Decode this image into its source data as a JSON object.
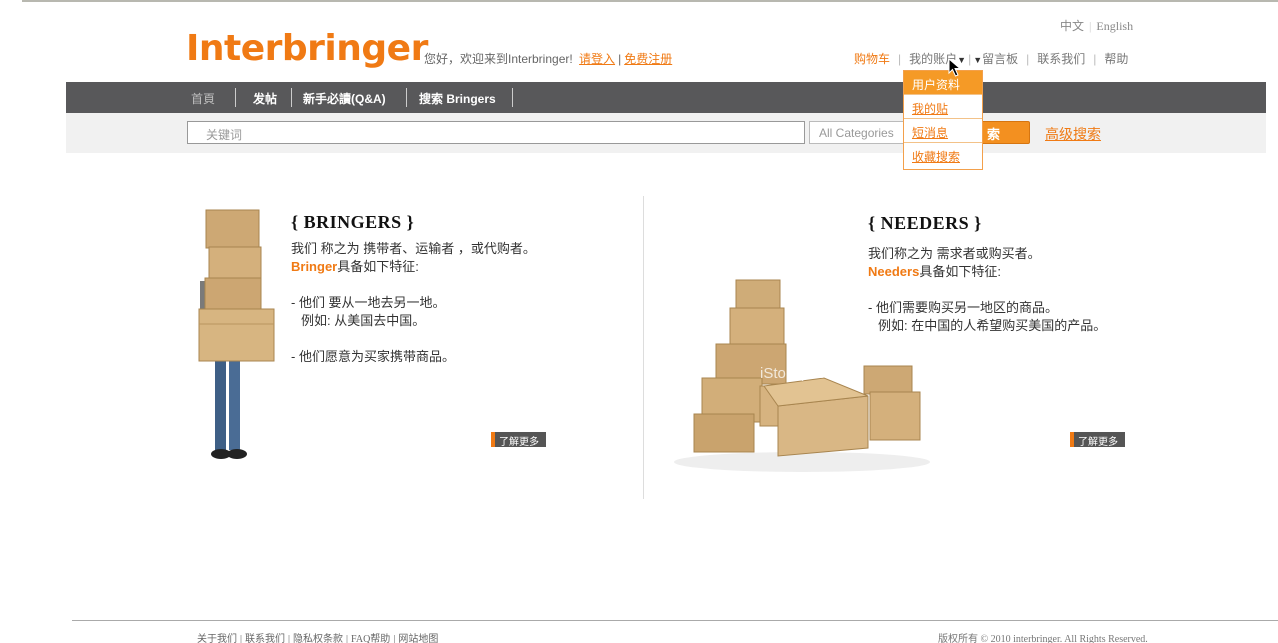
{
  "header": {
    "lang": {
      "zh": "中文",
      "en": "English"
    },
    "logo": "Interbringer",
    "welcome": "您好，欢迎来到Interbringer!",
    "login": "请登入",
    "register": "免费注册",
    "topnav": {
      "cart": "购物车",
      "account": "我的账户",
      "board": "留言板",
      "contact": "联系我们",
      "help": "帮助"
    }
  },
  "nav": {
    "items": [
      "首頁",
      "发帖",
      "新手必讀(Q&A)",
      "搜索 Bringers"
    ]
  },
  "search": {
    "placeholder": "关键词",
    "category": "All Categories",
    "button": "索",
    "advanced": "高级搜索"
  },
  "account_menu": {
    "items": [
      "用户资料",
      "我的贴",
      "短消息",
      "收藏搜索"
    ]
  },
  "bringers": {
    "title": "{ BRINGERS }",
    "line1": "我们 称之为 携带者、运输者 ，或代购者。",
    "hl": "Bringer",
    "line2": "具备如下特征:",
    "item1": "-  他们 要从一地去另一地。",
    "item1b": "例如:  从美国去中国。",
    "item2": "- 他们愿意为买家携带商品。",
    "more": "了解更多"
  },
  "needers": {
    "title": "{ NEEDERS }",
    "line1": "我们称之为 需求者或购买者。",
    "hl": "Needers",
    "line2": "具备如下特征:",
    "item1": "-  他们需要购买另一地区的商品。",
    "item1b": "例如:  在中国的人希望购买美国的产品。",
    "more": "了解更多",
    "watermark": "iStockphoto"
  },
  "footer": {
    "links": [
      "关于我们",
      "联系我们",
      "隐私权条款",
      "FAQ帮助",
      "网站地图"
    ],
    "copyright": "版权所有 © 2010 interbringer. All Rights Reserved."
  },
  "colors": {
    "accent": "#f07a14",
    "nav_bg": "#58585a",
    "search_bg": "#f1f1f1"
  }
}
